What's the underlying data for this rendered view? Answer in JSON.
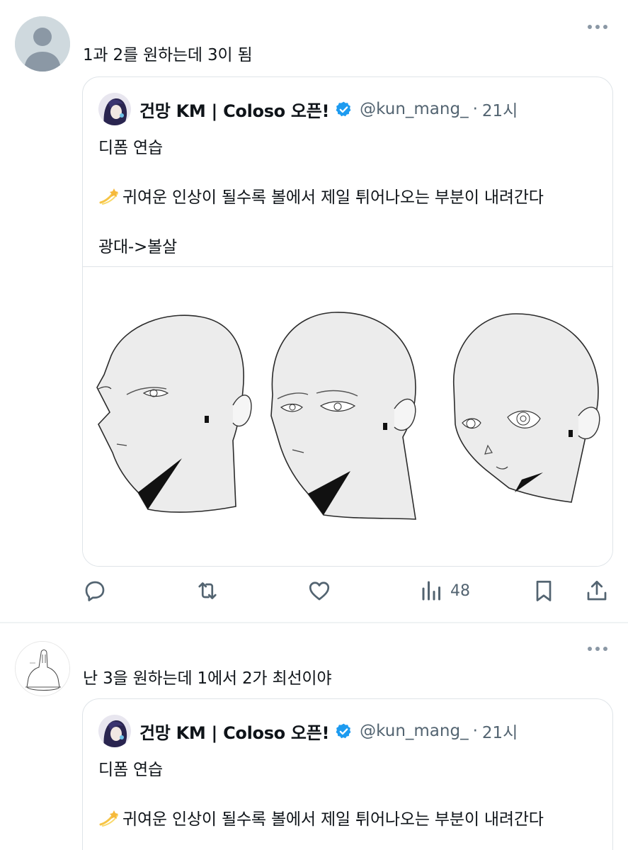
{
  "posts": [
    {
      "reply_text": "1과 2를 원하는데 3이 됨",
      "quote": {
        "name": "건망 KM | Coloso 오픈!",
        "handle": "@kun_mang_",
        "separator": "·",
        "time": "21시",
        "line1": "디폼 연습",
        "line2": "귀여운 인상이 될수록 볼에서 제일 튀어나오는 부분이 내려간다",
        "line3": "광대->볼살"
      },
      "actions": {
        "reply_icon": "reply-icon",
        "retweet_icon": "retweet-icon",
        "like_icon": "heart-icon",
        "views_icon": "views-chart-icon",
        "views_count": "48",
        "bookmark_icon": "bookmark-icon",
        "share_icon": "share-icon"
      }
    },
    {
      "reply_text": "난 3을 원하는데 1에서 2가 최선이야",
      "quote": {
        "name": "건망 KM | Coloso 오픈!",
        "handle": "@kun_mang_",
        "separator": "·",
        "time": "21시",
        "line1": "디폼 연습",
        "line2": "귀여운 인상이 될수록 볼에서 제일 튀어나오는 부분이 내려간다"
      }
    }
  ],
  "colors": {
    "verified_blue": "#1d9bf0",
    "text_primary": "#0f1419",
    "text_secondary": "#536471",
    "border": "#dfe4e8",
    "default_avatar_bg": "#cfd9de"
  }
}
